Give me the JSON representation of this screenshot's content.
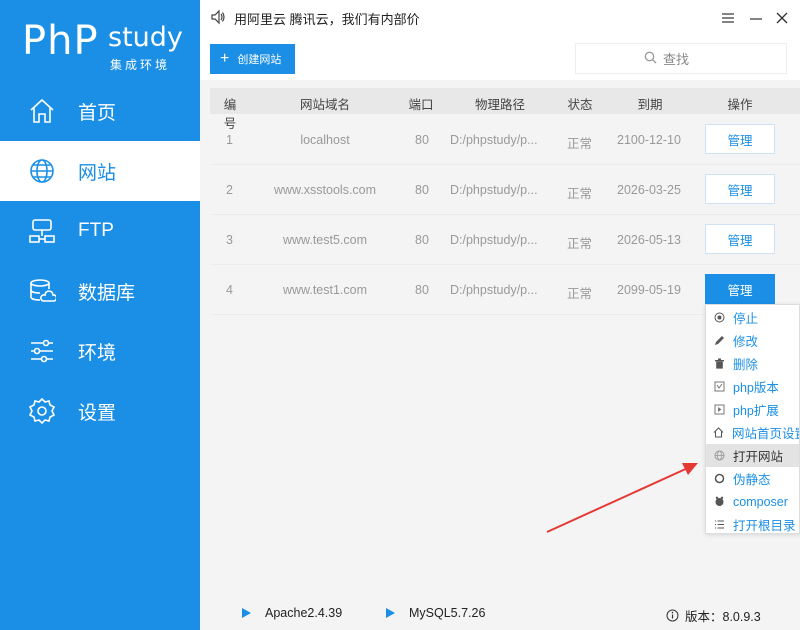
{
  "app": {
    "logo_php": "PhP",
    "logo_study": "study",
    "logo_sub": "集成环境"
  },
  "nav": [
    {
      "label": "首页",
      "icon": "home-icon",
      "active": false
    },
    {
      "label": "网站",
      "icon": "globe-icon",
      "active": true
    },
    {
      "label": "FTP",
      "icon": "ftp-icon",
      "active": false
    },
    {
      "label": "数据库",
      "icon": "database-icon",
      "active": false
    },
    {
      "label": "环境",
      "icon": "sliders-icon",
      "active": false
    },
    {
      "label": "设置",
      "icon": "gear-icon",
      "active": false
    }
  ],
  "topbar": {
    "notice": "用阿里云 腾讯云，我们有内部价"
  },
  "toolbar": {
    "create_label": "创建网站",
    "search_placeholder": "查找"
  },
  "table": {
    "headers": [
      "编号",
      "网站域名",
      "端口",
      "物理路径",
      "状态",
      "到期",
      "操作"
    ],
    "rows": [
      {
        "id": "1",
        "domain": "localhost",
        "port": "80",
        "path": "D:/phpstudy/p...",
        "status": "正常",
        "expire": "2100-12-10",
        "action": "管理"
      },
      {
        "id": "2",
        "domain": "www.xsstools.com",
        "port": "80",
        "path": "D:/phpstudy/p...",
        "status": "正常",
        "expire": "2026-03-25",
        "action": "管理"
      },
      {
        "id": "3",
        "domain": "www.test5.com",
        "port": "80",
        "path": "D:/phpstudy/p...",
        "status": "正常",
        "expire": "2026-05-13",
        "action": "管理"
      },
      {
        "id": "4",
        "domain": "www.test1.com",
        "port": "80",
        "path": "D:/phpstudy/p...",
        "status": "正常",
        "expire": "2099-05-19",
        "action": "管理"
      }
    ]
  },
  "menu": [
    {
      "label": "停止",
      "icon": "stop-icon"
    },
    {
      "label": "修改",
      "icon": "pencil-icon"
    },
    {
      "label": "删除",
      "icon": "trash-icon"
    },
    {
      "label": "php版本",
      "icon": "php-version-icon"
    },
    {
      "label": "php扩展",
      "icon": "php-extension-icon"
    },
    {
      "label": "网站首页设置",
      "icon": "home-icon"
    },
    {
      "label": "打开网站",
      "icon": "globe-icon",
      "highlighted": true
    },
    {
      "label": "伪静态",
      "icon": "rewrite-icon"
    },
    {
      "label": "composer",
      "icon": "composer-icon"
    },
    {
      "label": "打开根目录",
      "icon": "list-icon"
    }
  ],
  "statusbar": {
    "apache": "Apache2.4.39",
    "mysql": "MySQL5.7.26",
    "version": "版本：8.0.9.3"
  },
  "colors": {
    "accent": "#1b8fe6",
    "arrow": "#e53935"
  }
}
